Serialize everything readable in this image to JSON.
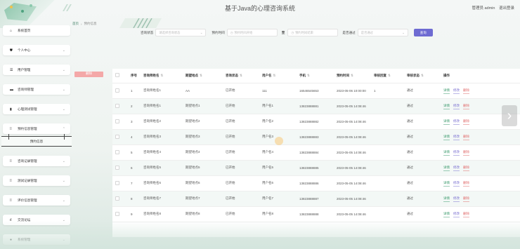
{
  "app": {
    "title": "基于Java的心理咨询系统",
    "user_role_label": "管理员 admin",
    "logout_label": "退出登录"
  },
  "breadcrumb": {
    "home": "首页",
    "current": "预约信息"
  },
  "sidebar": {
    "items": [
      {
        "label": "系统首页",
        "icon": "home-icon",
        "expanded": null
      },
      {
        "label": "个人中心",
        "icon": "user-icon",
        "expanded": false
      },
      {
        "label": "用户管理",
        "icon": "list-icon",
        "expanded": false
      },
      {
        "label": "咨询师管理",
        "icon": "briefcase-icon",
        "expanded": false
      },
      {
        "label": "心理测试管理",
        "icon": "book-icon",
        "expanded": false
      },
      {
        "label": "预约信息管理",
        "icon": "grid-icon",
        "expanded": true
      },
      {
        "label": "咨询记录管理",
        "icon": "grid-icon",
        "expanded": false
      },
      {
        "label": "测试记录管理",
        "icon": "grid-icon",
        "expanded": false
      },
      {
        "label": "评价信息管理",
        "icon": "grid-icon",
        "expanded": false
      },
      {
        "label": "交流论坛",
        "icon": "chart-icon",
        "expanded": false
      },
      {
        "label": "系统管理",
        "icon": "gear-icon",
        "expanded": false
      }
    ],
    "submenu_label": "预约信息"
  },
  "search": {
    "status_label": "咨询状态",
    "status_placeholder": "请选择咨询状态",
    "time_label": "预约时间",
    "time_start_placeholder": "预约时间开始",
    "time_to": "至",
    "time_end_placeholder": "预约时间结束",
    "approved_label": "是否通过",
    "approved_placeholder": "是否通过",
    "query_button": "查询"
  },
  "toolbar": {
    "delete_label": "删除"
  },
  "table": {
    "headers": [
      "",
      "序号",
      "咨询师姓名",
      "期望地点",
      "咨询状态",
      "用户名",
      "手机",
      "预约时间",
      "审核回复",
      "审核状态",
      "操作"
    ],
    "sortable": [
      false,
      false,
      true,
      true,
      true,
      true,
      true,
      true,
      true,
      true,
      false
    ],
    "rows": [
      {
        "no": "1",
        "name": "咨询师姓名1",
        "place": "AA",
        "status": "已开始",
        "user": "111",
        "phone": "16546545653",
        "time": "2023-05-06 10:00:00",
        "reply": "1",
        "audit": "通过"
      },
      {
        "no": "2",
        "name": "咨询师姓名1",
        "place": "期望地点1",
        "status": "已开始",
        "user": "用户名1",
        "phone": "13823888881",
        "time": "2023-05-05 14:08:46",
        "reply": "",
        "audit": "通过"
      },
      {
        "no": "3",
        "name": "咨询师姓名2",
        "place": "期望地点2",
        "status": "已开始",
        "user": "用户名2",
        "phone": "13823888882",
        "time": "2023-05-05 14:08:46",
        "reply": "",
        "audit": "通过"
      },
      {
        "no": "4",
        "name": "咨询师姓名3",
        "place": "期望地点3",
        "status": "已开始",
        "user": "用户名3",
        "phone": "13823888883",
        "time": "2023-05-05 14:08:46",
        "reply": "",
        "audit": "通过"
      },
      {
        "no": "5",
        "name": "咨询师姓名4",
        "place": "期望地点4",
        "status": "已开始",
        "user": "用户名4",
        "phone": "13823888884",
        "time": "2023-05-05 14:08:46",
        "reply": "",
        "audit": "通过"
      },
      {
        "no": "6",
        "name": "咨询师姓名5",
        "place": "期望地点5",
        "status": "已开始",
        "user": "用户名5",
        "phone": "13823888885",
        "time": "2023-05-05 14:08:46",
        "reply": "",
        "audit": "通过"
      },
      {
        "no": "7",
        "name": "咨询师姓名6",
        "place": "期望地点6",
        "status": "已开始",
        "user": "用户名6",
        "phone": "13823888886",
        "time": "2023-05-05 14:08:46",
        "reply": "",
        "audit": "通过"
      },
      {
        "no": "8",
        "name": "咨询师姓名7",
        "place": "期望地点7",
        "status": "已开始",
        "user": "用户名7",
        "phone": "13823888887",
        "time": "2023-05-05 14:08:46",
        "reply": "",
        "audit": "通过"
      },
      {
        "no": "9",
        "name": "咨询师姓名8",
        "place": "期望地点8",
        "status": "已开始",
        "user": "用户名8",
        "phone": "13823888888",
        "time": "2023-05-05 14:08:46",
        "reply": "",
        "audit": "通过"
      }
    ],
    "actions": [
      "详情",
      "修改",
      "删除"
    ]
  },
  "colors": {
    "accent": "#6e6bd2",
    "delete": "#f4a8a8",
    "detail": "#3c9a6d",
    "edit": "#7a6fd0",
    "danger": "#e06b6b"
  }
}
